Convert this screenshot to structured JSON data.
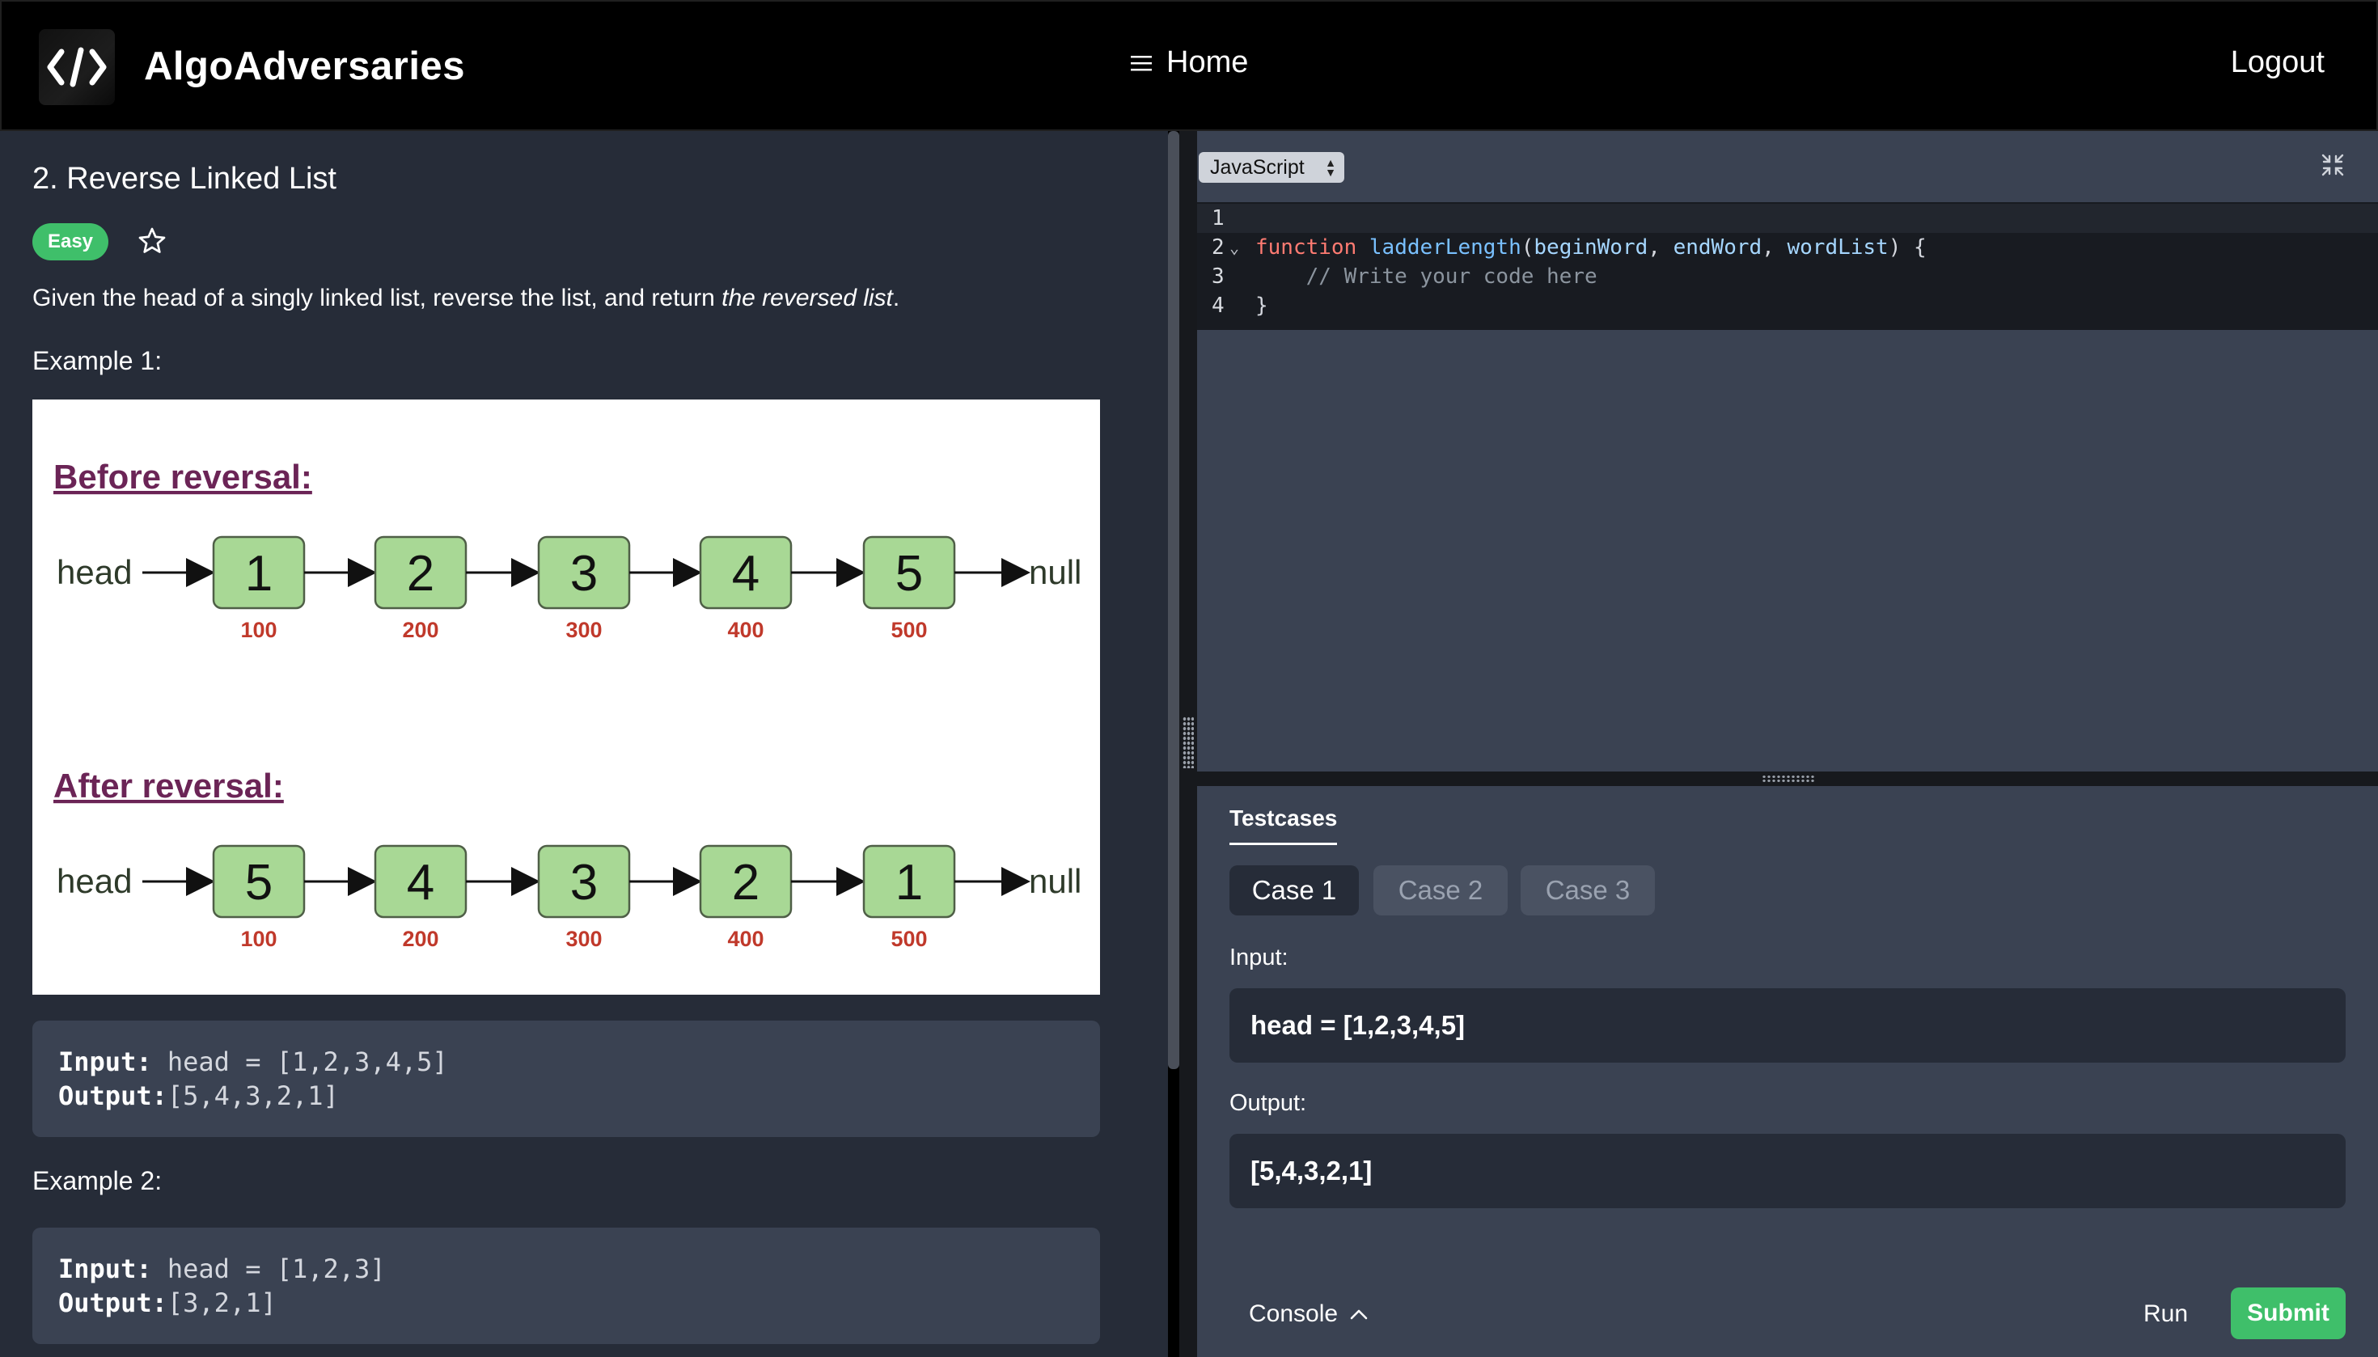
{
  "header": {
    "brand": "AlgoAdversaries",
    "logo_glyph": "</>",
    "nav_home": "Home",
    "logout": "Logout"
  },
  "problem": {
    "title": "2. Reverse Linked List",
    "difficulty": "Easy",
    "description_prefix": "Given the head of a singly linked list, reverse the list, and return ",
    "description_emphasis": "the reversed list",
    "description_suffix": ".",
    "example1_label": "Example 1:",
    "example1": {
      "input_key": "Input:",
      "input_value": " head = [1,2,3,4,5]",
      "output_key": "Output:",
      "output_value": "[5,4,3,2,1]"
    },
    "example2_label": "Example 2:",
    "example2": {
      "input_key": "Input:",
      "input_value": " head = [1,2,3]",
      "output_key": "Output:",
      "output_value": "[3,2,1]"
    },
    "diagram": {
      "before_title": "Before reversal:",
      "after_title": "After reversal:",
      "head_label": "head",
      "null_label": "null",
      "before_nodes": [
        "1",
        "2",
        "3",
        "4",
        "5"
      ],
      "after_nodes": [
        "5",
        "4",
        "3",
        "2",
        "1"
      ],
      "addresses": [
        "100",
        "200",
        "300",
        "400",
        "500"
      ]
    }
  },
  "editor": {
    "language": "JavaScript",
    "line_numbers": [
      "1",
      "2",
      "3",
      "4"
    ],
    "line2": {
      "kw": "function",
      "name": " ladderLength",
      "open": "(",
      "p1": "beginWord",
      "c1": ", ",
      "p2": "endWord",
      "c2": ", ",
      "p3": "wordList",
      "close": ") {"
    },
    "line3": "    // Write your code here",
    "line4": "}"
  },
  "testcases": {
    "tab_label": "Testcases",
    "cases": [
      "Case 1",
      "Case 2",
      "Case 3"
    ],
    "input_label": "Input:",
    "input_value": "head = [1,2,3,4,5]",
    "output_label": "Output:",
    "output_value": "[5,4,3,2,1]"
  },
  "footer": {
    "console": "Console",
    "run": "Run",
    "submit": "Submit"
  },
  "colors": {
    "accent_green": "#3fbf6a",
    "panel_dark": "#262c38",
    "panel_mid": "#3a4252",
    "node_fill": "#a8d895",
    "address_red": "#c0392b",
    "heading_purple": "#6b2456"
  }
}
